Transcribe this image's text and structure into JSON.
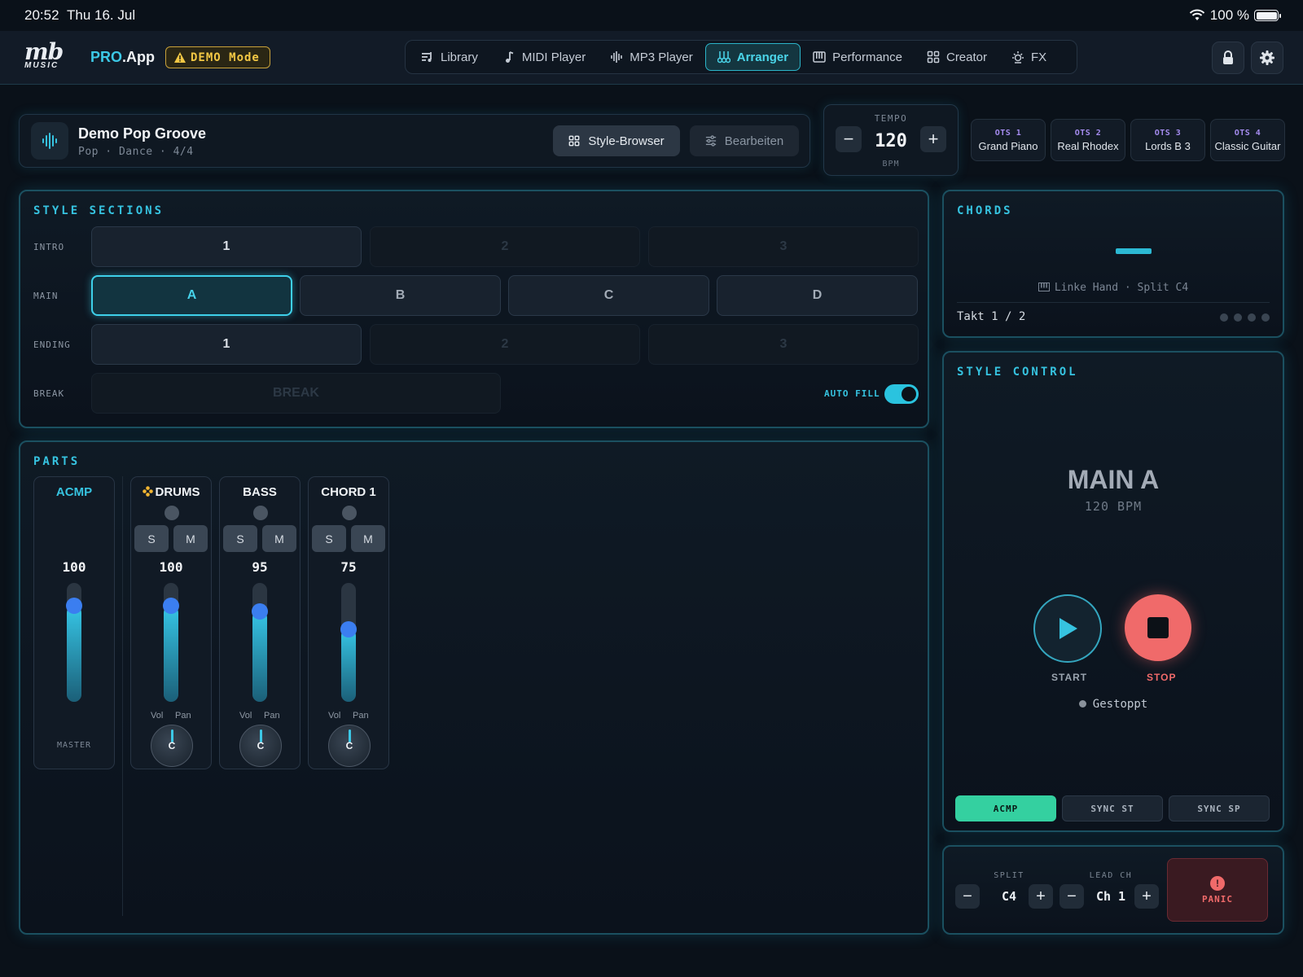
{
  "status_bar": {
    "time": "20:52",
    "date": "Thu 16. Jul",
    "battery": "100 %"
  },
  "header": {
    "logo_text": "mb",
    "logo_sub": "MUSIC",
    "app_pro": "PRO",
    "app_rest": ".App",
    "demo_badge": "DEMO Mode",
    "nav": [
      {
        "label": "Library",
        "icon": "library-icon"
      },
      {
        "label": "MIDI Player",
        "icon": "note-icon"
      },
      {
        "label": "MP3 Player",
        "icon": "waveform-icon"
      },
      {
        "label": "Arranger",
        "icon": "arranger-icon",
        "active": true
      },
      {
        "label": "Performance",
        "icon": "piano-icon"
      },
      {
        "label": "Creator",
        "icon": "grid-icon"
      },
      {
        "label": "FX",
        "icon": "fx-icon"
      }
    ]
  },
  "style": {
    "title": "Demo Pop Groove",
    "subtitle": "Pop · Dance · 4/4",
    "browser_label": "Style-Browser",
    "edit_label": "Bearbeiten"
  },
  "tempo": {
    "label": "TEMPO",
    "value": "120",
    "unit": "BPM"
  },
  "ots": [
    {
      "tag": "OTS 1",
      "name": "Grand Piano"
    },
    {
      "tag": "OTS 2",
      "name": "Real Rhodex"
    },
    {
      "tag": "OTS 3",
      "name": "Lords B 3"
    },
    {
      "tag": "OTS 4",
      "name": "Classic Guitar"
    }
  ],
  "style_sections": {
    "title": "STYLE SECTIONS",
    "intro_label": "INTRO",
    "intro": [
      "1",
      "2",
      "3"
    ],
    "main_label": "MAIN",
    "main": [
      "A",
      "B",
      "C",
      "D"
    ],
    "ending_label": "ENDING",
    "ending": [
      "1",
      "2",
      "3"
    ],
    "break_label": "BREAK",
    "break_button": "BREAK",
    "auto_fill_label": "AUTO FILL",
    "auto_fill_on": true
  },
  "chords": {
    "title": "CHORDS",
    "current": "—",
    "info": "Linke Hand · Split C4",
    "takt": "Takt 1 / 2"
  },
  "style_control": {
    "title": "STYLE CONTROL",
    "section": "MAIN A",
    "bpm": "120 BPM",
    "start_label": "START",
    "stop_label": "STOP",
    "status": "Gestoppt",
    "modes": [
      "ACMP",
      "SYNC ST",
      "SYNC SP"
    ]
  },
  "split_lead": {
    "split_label": "SPLIT",
    "split_value": "C4",
    "lead_label": "LEAD CH",
    "lead_value": "Ch 1",
    "panic_label": "PANIC"
  },
  "parts": {
    "title": "PARTS",
    "vol_label": "Vol",
    "pan_label": "Pan",
    "pan_value": "C",
    "solo": "S",
    "mute": "M",
    "master": {
      "name": "ACMP",
      "volume": "100",
      "sub": "MASTER"
    },
    "strips": [
      {
        "name": "DRUMS",
        "volume": "100"
      },
      {
        "name": "BASS",
        "volume": "95"
      },
      {
        "name": "CHORD 1",
        "volume": "75"
      }
    ]
  },
  "colors": {
    "accent": "#36c3e0",
    "stop": "#f06a6a",
    "acmp_on": "#34d0a0",
    "demo": "#f2c744",
    "ots_tag": "#a58cf0"
  }
}
